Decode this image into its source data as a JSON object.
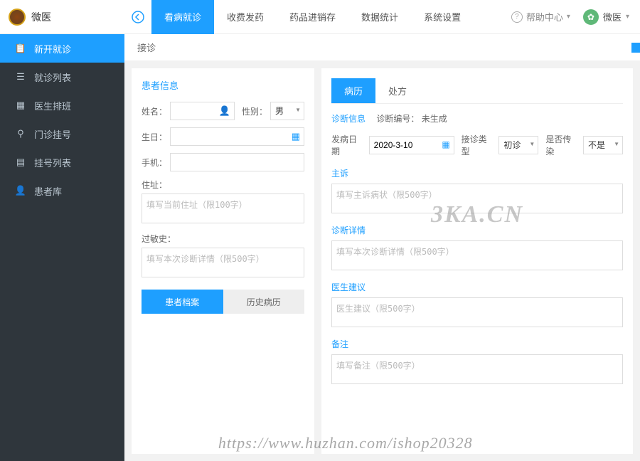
{
  "header": {
    "app_name": "微医",
    "nav": [
      "看病就诊",
      "收费发药",
      "药品进销存",
      "数据统计",
      "系统设置"
    ],
    "help": "帮助中心",
    "user_name": "微医"
  },
  "sidebar": {
    "items": [
      {
        "icon": "clipboard",
        "label": "新开就诊"
      },
      {
        "icon": "list",
        "label": "就诊列表"
      },
      {
        "icon": "calendar",
        "label": "医生排班"
      },
      {
        "icon": "ticket",
        "label": "门诊挂号"
      },
      {
        "icon": "rows",
        "label": "挂号列表"
      },
      {
        "icon": "user",
        "label": "患者库"
      }
    ]
  },
  "breadcrumb": "接诊",
  "patient_panel": {
    "title": "患者信息",
    "name_label": "姓名：",
    "gender_label": "性别：",
    "gender_value": "男",
    "birth_label": "生日：",
    "phone_label": "手机：",
    "address_label": "住址：",
    "address_placeholder": "填写当前住址（限100字）",
    "allergy_label": "过敏史：",
    "allergy_placeholder": "填写本次诊断详情（限500字）",
    "tab_records": "患者档案",
    "tab_history": "历史病历"
  },
  "diagnosis_panel": {
    "tabs": [
      "病历",
      "处方"
    ],
    "info_label": "诊断信息",
    "diag_no_label": "诊断编号：",
    "diag_no_value": "未生成",
    "onset_date_label": "发病日期",
    "onset_date_value": "2020-3-10",
    "visit_type_label": "接诊类型",
    "visit_type_value": "初诊",
    "infectious_label": "是否传染",
    "infectious_value": "不是",
    "chief_title": "主诉",
    "chief_placeholder": "填写主诉病状（限500字）",
    "detail_title": "诊断详情",
    "detail_placeholder": "填写本次诊断详情（限500字）",
    "advice_title": "医生建议",
    "advice_placeholder": "医生建议（限500字）",
    "remark_title": "备注",
    "remark_placeholder": "填写备注（限500字）"
  },
  "watermarks": {
    "w1": "3KA.CN",
    "w2": "https://www.huzhan.com/ishop20328"
  }
}
